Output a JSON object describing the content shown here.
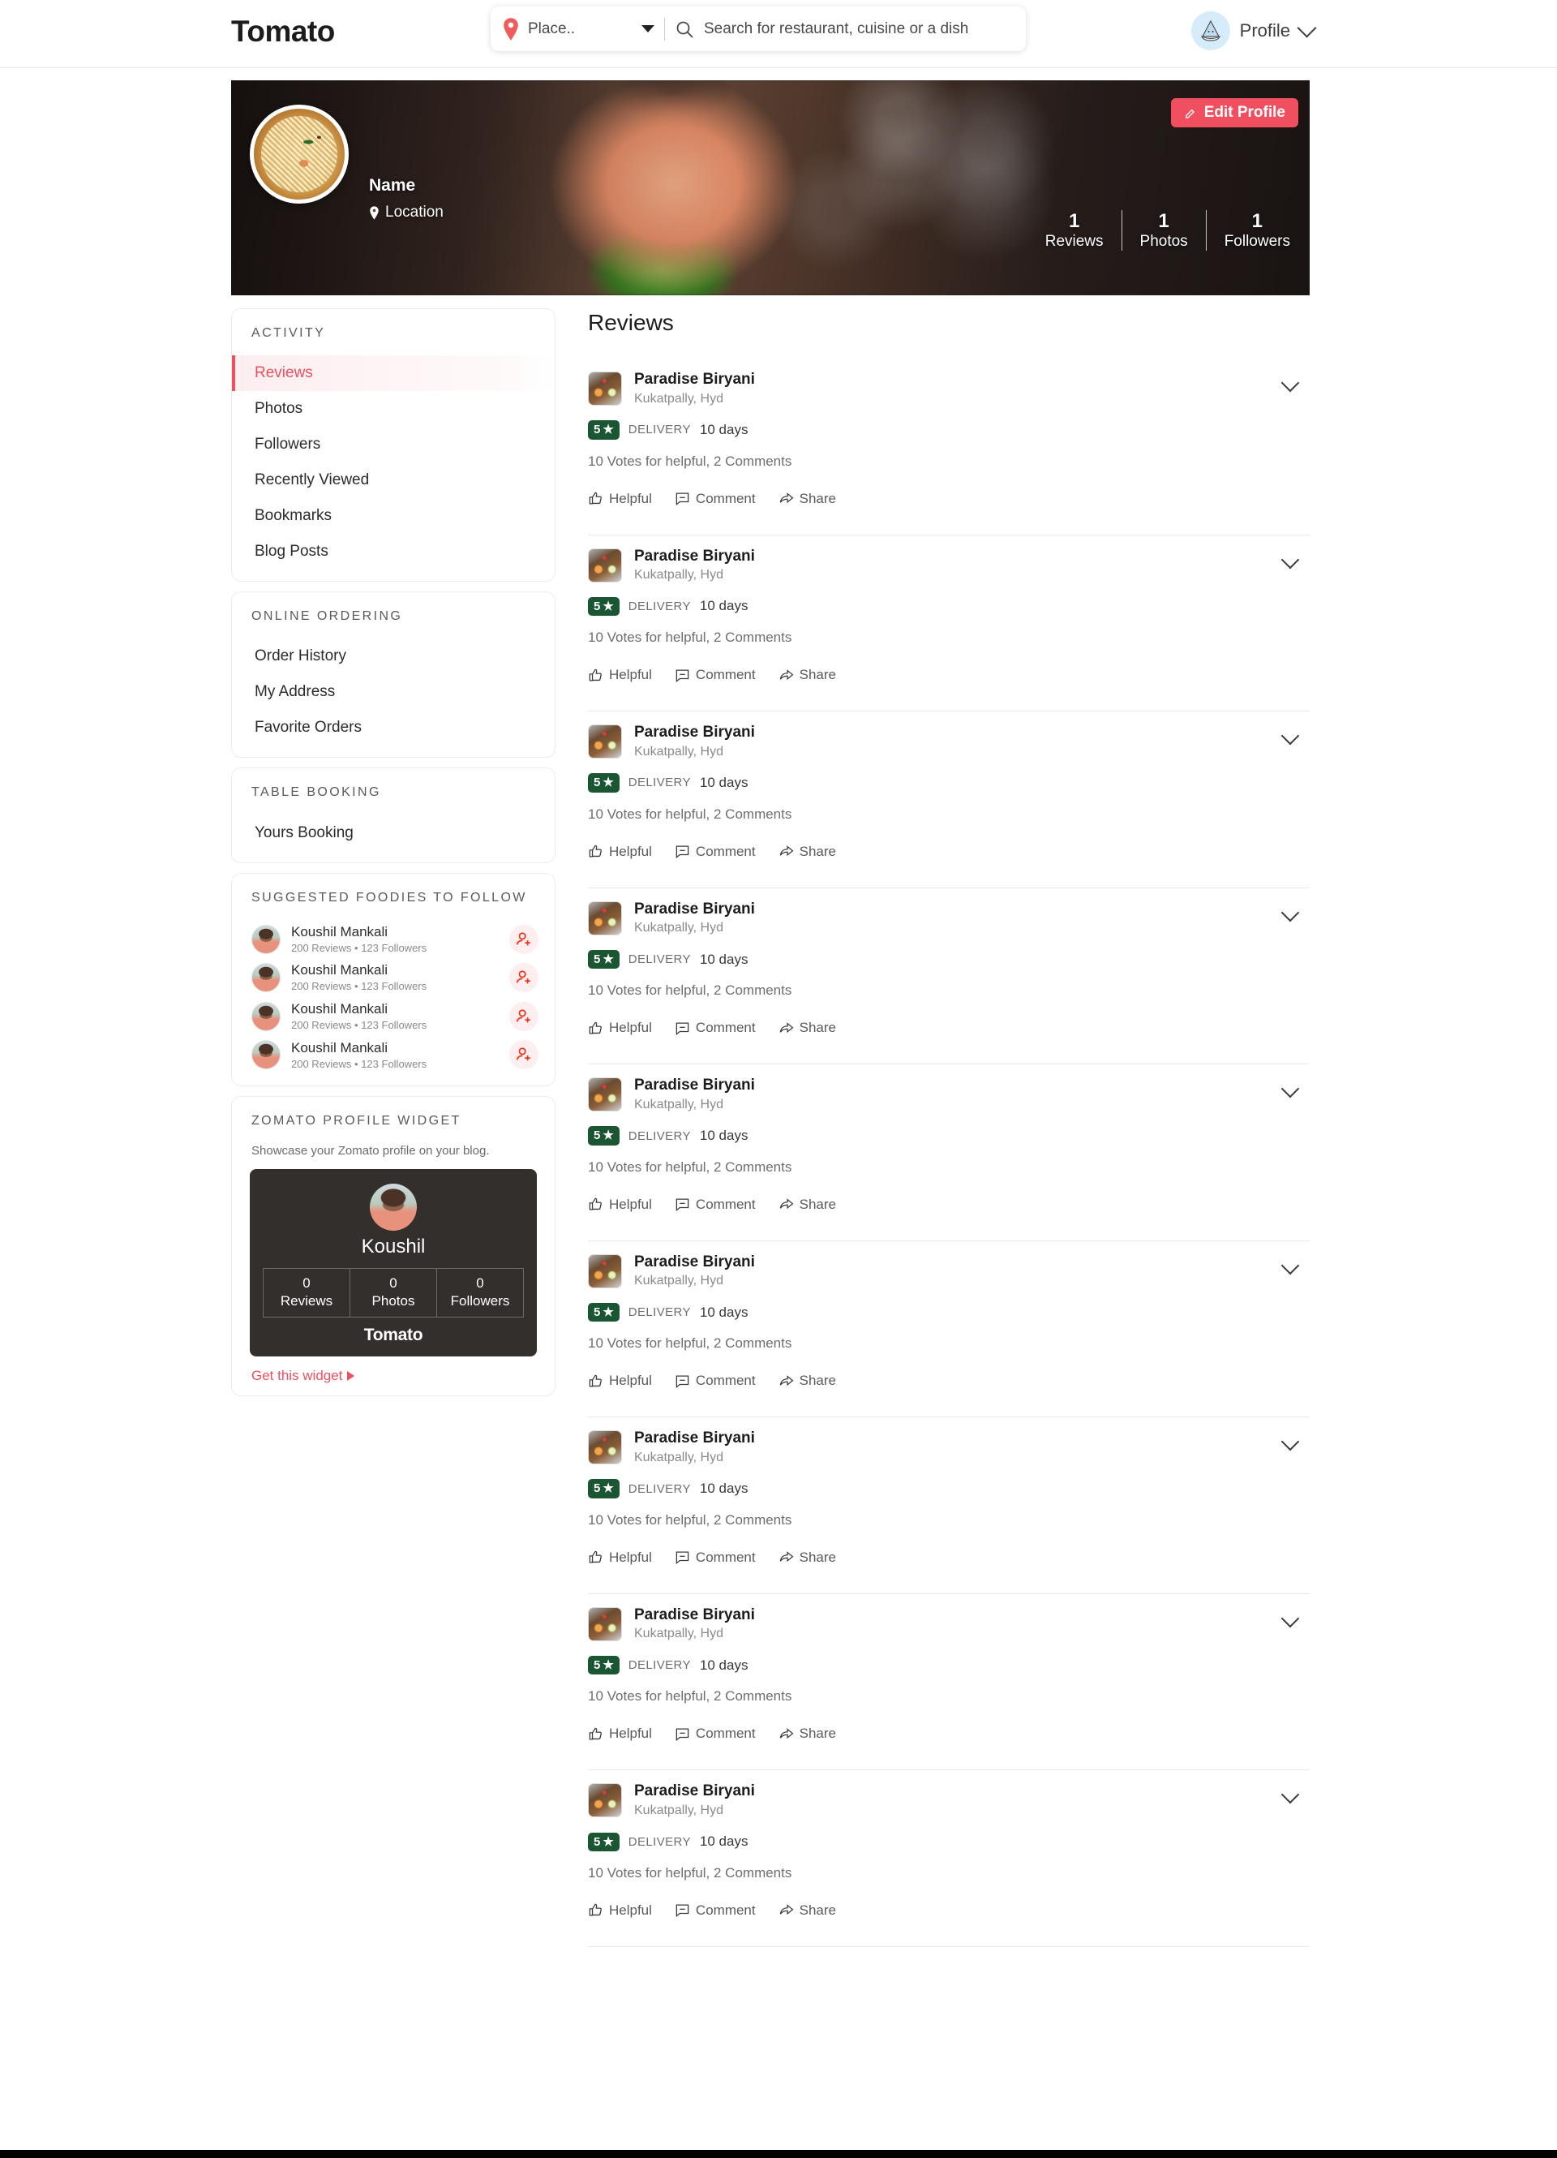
{
  "header": {
    "brand": "Tomato",
    "location_icon": "location-pin-icon",
    "location_value": "Place..",
    "search_placeholder": "Search for restaurant, cuisine or a dish",
    "search_value": "",
    "profile_label": "Profile"
  },
  "banner": {
    "name": "Name",
    "location": "Location",
    "edit_label": "Edit Profile",
    "stats": [
      {
        "num": "1",
        "label": "Reviews"
      },
      {
        "num": "1",
        "label": "Photos"
      },
      {
        "num": "1",
        "label": "Followers"
      }
    ]
  },
  "sidebar": {
    "activity": {
      "title": "ACTIVITY",
      "items": [
        {
          "label": "Reviews",
          "active": true
        },
        {
          "label": "Photos",
          "active": false
        },
        {
          "label": "Followers",
          "active": false
        },
        {
          "label": "Recently Viewed",
          "active": false
        },
        {
          "label": "Bookmarks",
          "active": false
        },
        {
          "label": "Blog Posts",
          "active": false
        }
      ]
    },
    "online_ordering": {
      "title": "ONLINE ORDERING",
      "items": [
        {
          "label": "Order History"
        },
        {
          "label": "My Address"
        },
        {
          "label": "Favorite Orders"
        }
      ]
    },
    "table_booking": {
      "title": "TABLE BOOKING",
      "items": [
        {
          "label": "Yours Booking"
        }
      ]
    },
    "suggested": {
      "title": "SUGGESTED FOODIES TO FOLLOW",
      "people": [
        {
          "name": "Koushil Mankali",
          "meta": "200 Reviews  •  123 Followers"
        },
        {
          "name": "Koushil Mankali",
          "meta": "200 Reviews  •  123 Followers"
        },
        {
          "name": "Koushil Mankali",
          "meta": "200 Reviews  •  123 Followers"
        },
        {
          "name": "Koushil Mankali",
          "meta": "200 Reviews  •  123 Followers"
        }
      ]
    },
    "widget": {
      "title": "ZOMATO PROFILE WIDGET",
      "subtitle": "Showcase your Zomato profile on your blog.",
      "name": "Koushil",
      "stats": [
        {
          "num": "0",
          "label": "Reviews"
        },
        {
          "num": "0",
          "label": "Photos"
        },
        {
          "num": "0",
          "label": "Followers"
        }
      ],
      "brand": "Tomato",
      "get_widget": "Get this widget"
    }
  },
  "main": {
    "title": "Reviews",
    "action_labels": {
      "helpful": "Helpful",
      "comment": "Comment",
      "share": "Share"
    },
    "reviews": [
      {
        "restaurant": "Paradise Biryani",
        "location": "Kukatpally, Hyd",
        "rating": "5",
        "order_type": "DELIVERY",
        "age": "10 days",
        "votes": "10 Votes for helpful, 2 Comments"
      },
      {
        "restaurant": "Paradise Biryani",
        "location": "Kukatpally, Hyd",
        "rating": "5",
        "order_type": "DELIVERY",
        "age": "10 days",
        "votes": "10 Votes for helpful, 2 Comments"
      },
      {
        "restaurant": "Paradise Biryani",
        "location": "Kukatpally, Hyd",
        "rating": "5",
        "order_type": "DELIVERY",
        "age": "10 days",
        "votes": "10 Votes for helpful, 2 Comments"
      },
      {
        "restaurant": "Paradise Biryani",
        "location": "Kukatpally, Hyd",
        "rating": "5",
        "order_type": "DELIVERY",
        "age": "10 days",
        "votes": "10 Votes for helpful, 2 Comments"
      },
      {
        "restaurant": "Paradise Biryani",
        "location": "Kukatpally, Hyd",
        "rating": "5",
        "order_type": "DELIVERY",
        "age": "10 days",
        "votes": "10 Votes for helpful, 2 Comments"
      },
      {
        "restaurant": "Paradise Biryani",
        "location": "Kukatpally, Hyd",
        "rating": "5",
        "order_type": "DELIVERY",
        "age": "10 days",
        "votes": "10 Votes for helpful, 2 Comments"
      },
      {
        "restaurant": "Paradise Biryani",
        "location": "Kukatpally, Hyd",
        "rating": "5",
        "order_type": "DELIVERY",
        "age": "10 days",
        "votes": "10 Votes for helpful, 2 Comments"
      },
      {
        "restaurant": "Paradise Biryani",
        "location": "Kukatpally, Hyd",
        "rating": "5",
        "order_type": "DELIVERY",
        "age": "10 days",
        "votes": "10 Votes for helpful, 2 Comments"
      },
      {
        "restaurant": "Paradise Biryani",
        "location": "Kukatpally, Hyd",
        "rating": "5",
        "order_type": "DELIVERY",
        "age": "10 days",
        "votes": "10 Votes for helpful, 2 Comments"
      }
    ]
  },
  "colors": {
    "accent": "#ef4f5f",
    "rating_green": "#1b5632",
    "widget_bg": "#332f2c"
  }
}
